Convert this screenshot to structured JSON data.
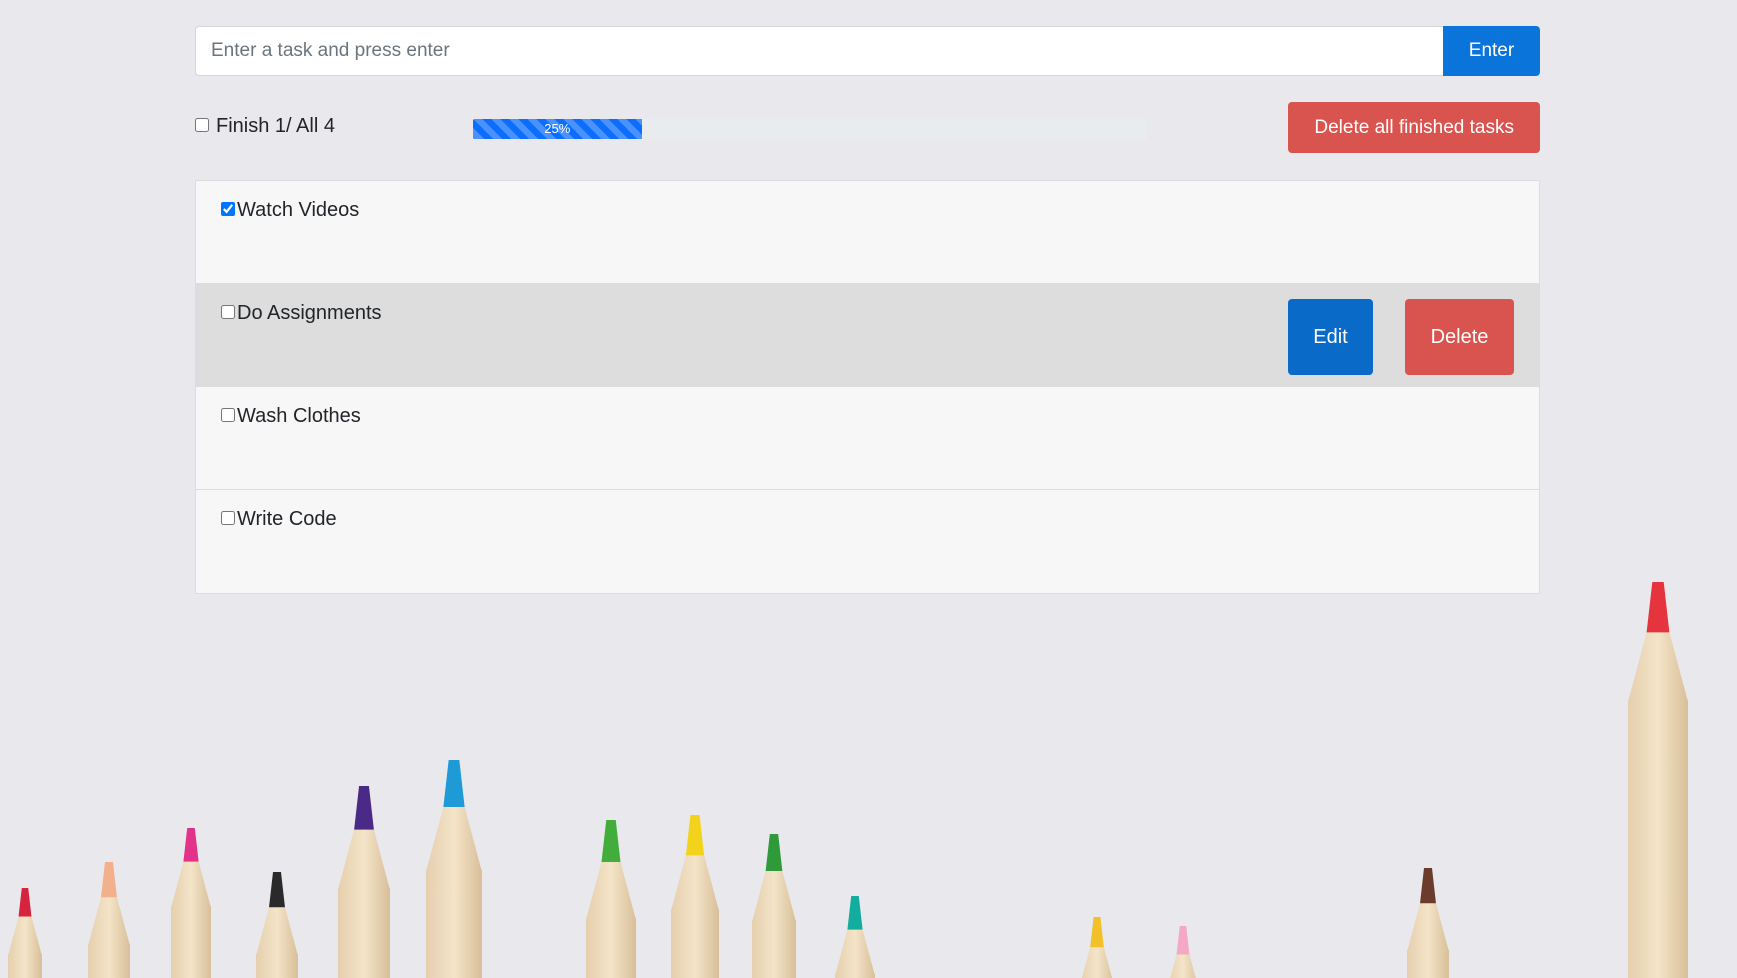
{
  "input": {
    "placeholder": "Enter a task and press enter",
    "value": ""
  },
  "enter_button": "Enter",
  "status": {
    "finish_label": "Finish 1/ All 4",
    "finish_all_checked": false,
    "progress_percent": 25,
    "progress_text": "25%",
    "progress_color": "#0d6efd",
    "delete_finished_label": "Delete all finished tasks"
  },
  "tasks": [
    {
      "text": "Watch Videos",
      "checked": true
    },
    {
      "text": "Do Assignments",
      "checked": false
    },
    {
      "text": "Wash Clothes",
      "checked": false
    },
    {
      "text": "Write Code",
      "checked": false
    }
  ],
  "row_actions": {
    "edit_label": "Edit",
    "delete_label": "Delete"
  },
  "colors": {
    "primary": "#0a74da",
    "danger": "#d9534f",
    "row_hover": "#dddddd"
  },
  "pencil_colors": [
    "#d6243f",
    "#f2b08c",
    "#e2328a",
    "#2a2a2a",
    "#4a2a86",
    "#1e9ad6",
    "#43ad3c",
    "#f2d21b",
    "#2f9a3a",
    "#12ad9e",
    "#f2c12a",
    "#f3a9c4",
    "#6b3b2b",
    "#e6343f"
  ]
}
